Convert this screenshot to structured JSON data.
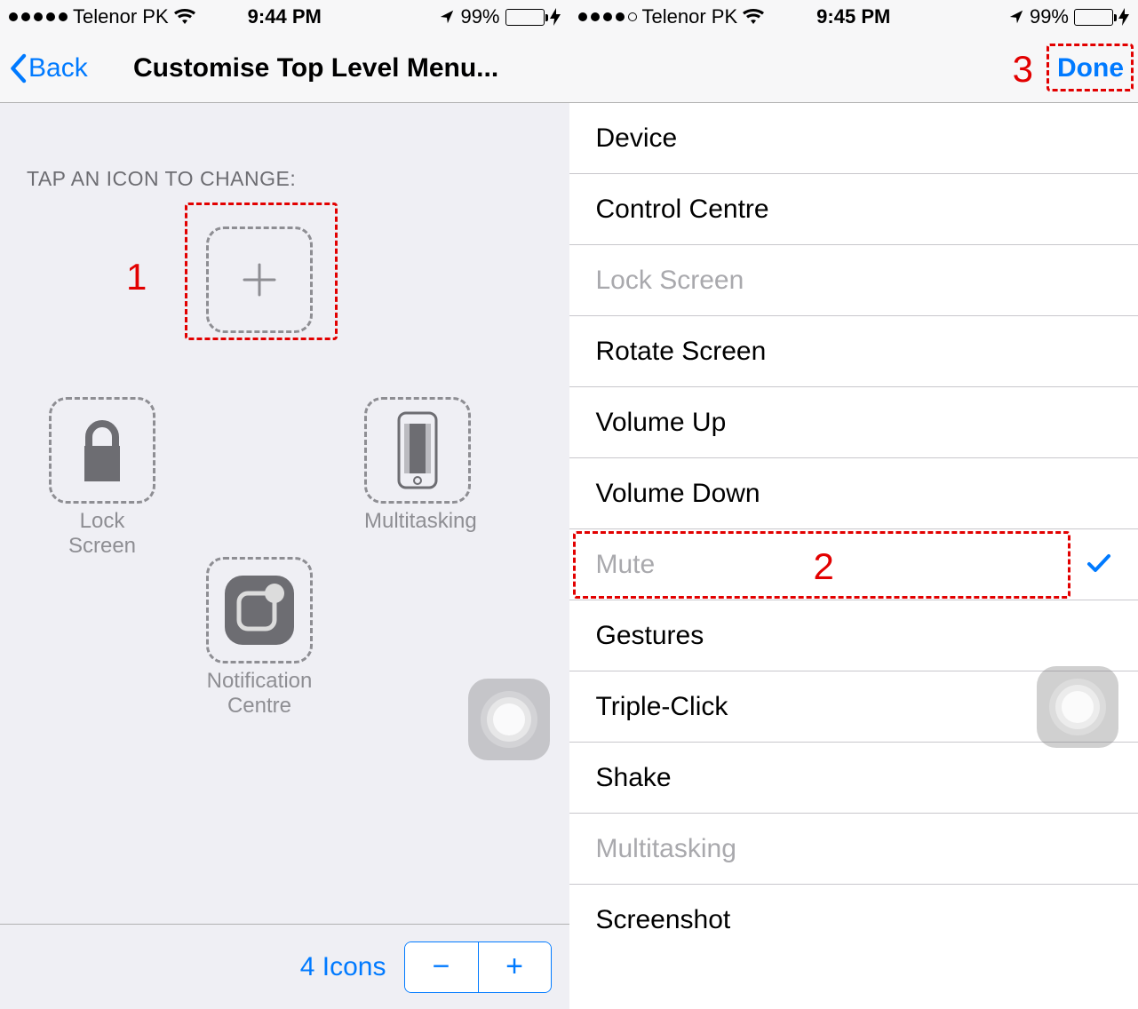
{
  "left": {
    "status": {
      "carrier": "Telenor PK",
      "time": "9:44 PM",
      "battery_pct": "99%",
      "signal_filled": 5
    },
    "nav": {
      "back": "Back",
      "title": "Customise Top Level Menu..."
    },
    "section_caption": "TAP AN ICON TO CHANGE:",
    "slots": {
      "top_empty": "",
      "lock_screen": "Lock Screen",
      "multitasking": "Multitasking",
      "notification_centre": "Notification Centre"
    },
    "bottom": {
      "count_label": "4 Icons"
    },
    "annotation_1": "1"
  },
  "right": {
    "status": {
      "carrier": "Telenor PK",
      "time": "9:45 PM",
      "battery_pct": "99%",
      "signal_filled": 4
    },
    "nav": {
      "done": "Done"
    },
    "items": [
      {
        "label": "Device",
        "disabled": false,
        "checked": false
      },
      {
        "label": "Control Centre",
        "disabled": false,
        "checked": false
      },
      {
        "label": "Lock Screen",
        "disabled": true,
        "checked": false
      },
      {
        "label": "Rotate Screen",
        "disabled": false,
        "checked": false
      },
      {
        "label": "Volume Up",
        "disabled": false,
        "checked": false
      },
      {
        "label": "Volume Down",
        "disabled": false,
        "checked": false
      },
      {
        "label": "Mute",
        "disabled": true,
        "checked": true
      },
      {
        "label": "Gestures",
        "disabled": false,
        "checked": false
      },
      {
        "label": "Triple-Click",
        "disabled": false,
        "checked": false
      },
      {
        "label": "Shake",
        "disabled": false,
        "checked": false
      },
      {
        "label": "Multitasking",
        "disabled": true,
        "checked": false
      },
      {
        "label": "Screenshot",
        "disabled": false,
        "checked": false
      }
    ],
    "annotation_2": "2",
    "annotation_3": "3"
  }
}
